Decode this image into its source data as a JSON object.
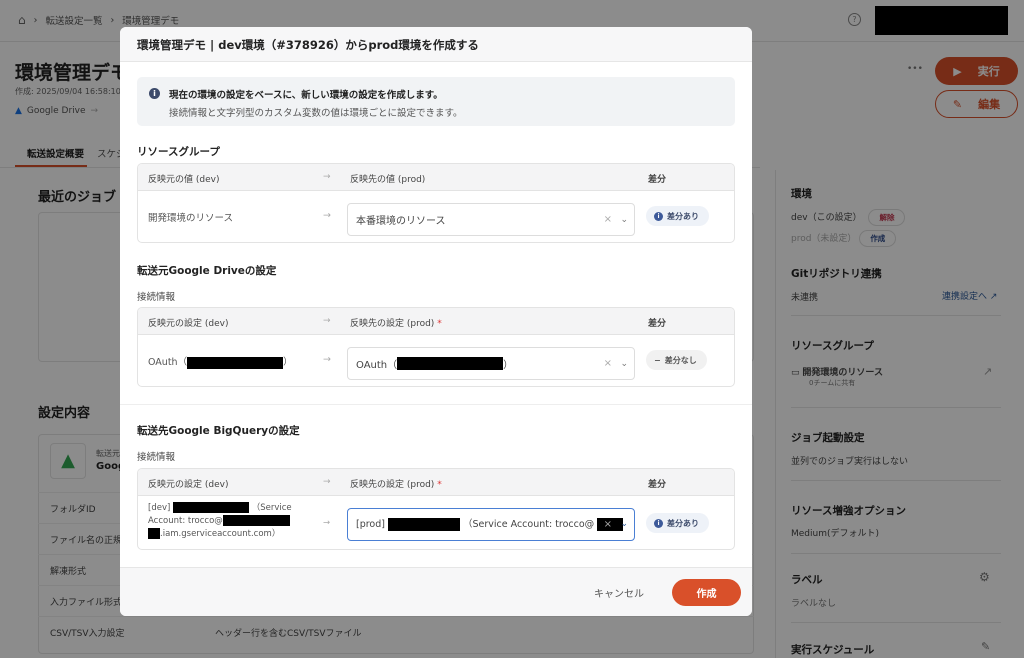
{
  "breadcrumb": {
    "items": [
      "転送設定一覧",
      "環境管理デモ"
    ]
  },
  "header": {
    "title": "環境管理デモ",
    "created": "作成: 2025/09/04 16:58:10 •",
    "source": "Google Drive",
    "run_label": "実行",
    "edit_label": "編集",
    "more": "•••"
  },
  "tabs": [
    "転送設定概要",
    "スケジ"
  ],
  "main": {
    "recent_jobs": "最近のジョブ",
    "settings_title": "設定内容",
    "source_type": "転送元",
    "source_name": "Goog",
    "rows": [
      {
        "label": "フォルダID",
        "value": ""
      },
      {
        "label": "ファイル名の正規表",
        "value": ""
      },
      {
        "label": "解凍形式",
        "value": ""
      },
      {
        "label": "入力ファイル形式",
        "value": ""
      },
      {
        "label": "CSV/TSV入力設定",
        "value": "ヘッダー行を含むCSV/TSVファイル"
      }
    ]
  },
  "sidebar": {
    "env_title": "環境",
    "env_dev": "dev（この設定）",
    "env_dev_action": "解除",
    "env_prod": "prod（未設定）",
    "env_prod_action": "作成",
    "git_title": "Gitリポジトリ連携",
    "git_status": "未連携",
    "git_link": "連携設定へ",
    "rg_title": "リソースグループ",
    "rg_name": "開発環境のリソース",
    "rg_shared": "0チームに共有",
    "job_title": "ジョブ起動設定",
    "job_value": "並列でのジョブ実行はしない",
    "boost_title": "リソース増強オプション",
    "boost_value": "Medium(デフォルト)",
    "label_title": "ラベル",
    "label_value": "ラベルなし",
    "schedule_title": "実行スケジュール"
  },
  "modal": {
    "title": "環境管理デモ | dev環境（#378926）からprod環境を作成する",
    "info_line1": "現在の環境の設定をベースに、新しい環境の設定を作成します。",
    "info_line2": "接続情報と文字列型のカスタム変数の値は環境ごとに設定できます。",
    "arrow": "→",
    "rg": {
      "title": "リソースグループ",
      "h_src": "反映元の値 (dev)",
      "h_dst": "反映先の値 (prod)",
      "h_diff": "差分",
      "src": "開発環境のリソース",
      "dst": "本番環境のリソース",
      "diff": "差分あり"
    },
    "drive": {
      "title": "転送元Google Driveの設定",
      "sub": "接続情報",
      "h_src": "反映元の設定 (dev)",
      "h_dst": "反映先の設定 (prod)",
      "req": "*",
      "h_diff": "差分",
      "src_prefix": "OAuth（",
      "src_suffix": "）",
      "dst_prefix": "OAuth（",
      "dst_suffix": "）",
      "diff": "差分なし"
    },
    "bq": {
      "title": "転送先Google BigQueryの設定",
      "sub": "接続情報",
      "h_src": "反映元の設定 (dev)",
      "h_dst": "反映先の設定 (prod)",
      "req": "*",
      "h_diff": "差分",
      "src_a": "[dev]",
      "src_b": "（Service",
      "src_c": "Account: trocco@",
      "src_d": ".iam.gserviceaccount.com）",
      "dst_a": "[prod]",
      "dst_b": "（Service Account: trocco@",
      "diff": "差分あり"
    },
    "cancel": "キャンセル",
    "create": "作成"
  }
}
